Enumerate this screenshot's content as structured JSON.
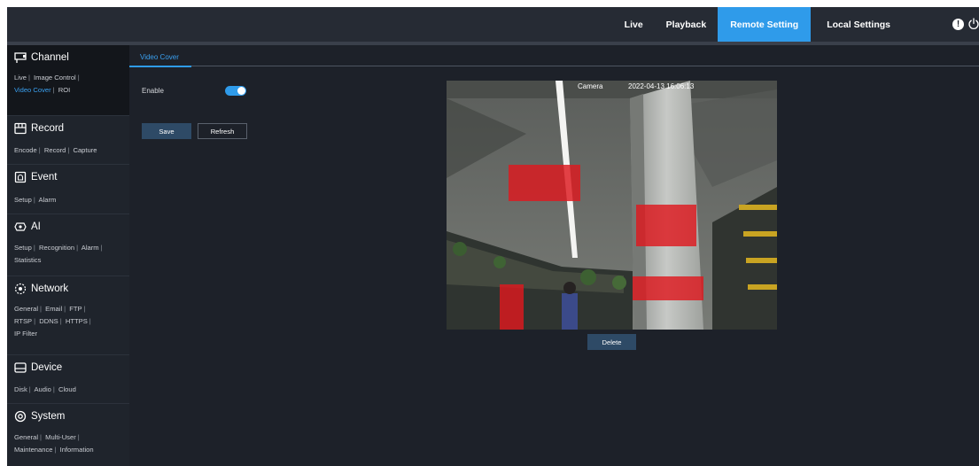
{
  "nav": {
    "items": [
      {
        "label": "Live"
      },
      {
        "label": "Playback"
      },
      {
        "label": "Remote Setting",
        "active": true
      },
      {
        "label": "Local Settings"
      }
    ],
    "icons": [
      "info-icon",
      "power-icon"
    ],
    "accent_color": "#2f9bea"
  },
  "sidebar": {
    "sections": [
      {
        "title": "Channel",
        "icon": "channel-icon",
        "links": [
          "Live",
          "Image Control",
          "Video Cover",
          "ROI"
        ],
        "current": "Video Cover"
      },
      {
        "title": "Record",
        "icon": "record-icon",
        "links": [
          "Encode",
          "Record",
          "Capture"
        ]
      },
      {
        "title": "Event",
        "icon": "event-icon",
        "links": [
          "Setup",
          "Alarm"
        ]
      },
      {
        "title": "AI",
        "icon": "ai-icon",
        "links": [
          "Setup",
          "Recognition",
          "Alarm",
          "Statistics"
        ]
      },
      {
        "title": "Network",
        "icon": "network-icon",
        "links": [
          "General",
          "Email",
          "FTP",
          "RTSP",
          "DDNS",
          "HTTPS",
          "IP Filter"
        ]
      },
      {
        "title": "Device",
        "icon": "device-icon",
        "links": [
          "Disk",
          "Audio",
          "Cloud"
        ]
      },
      {
        "title": "System",
        "icon": "system-icon",
        "links": [
          "General",
          "Multi-User",
          "Maintenance",
          "Information"
        ]
      }
    ]
  },
  "content": {
    "tab": "Video Cover",
    "enable_label": "Enable",
    "enable_on": true,
    "save_label": "Save",
    "refresh_label": "Refresh",
    "delete_label": "Delete",
    "video": {
      "osd_name": "Camera",
      "osd_time": "2022-04-13 16:06:13",
      "cover_color": "#de181e"
    }
  }
}
